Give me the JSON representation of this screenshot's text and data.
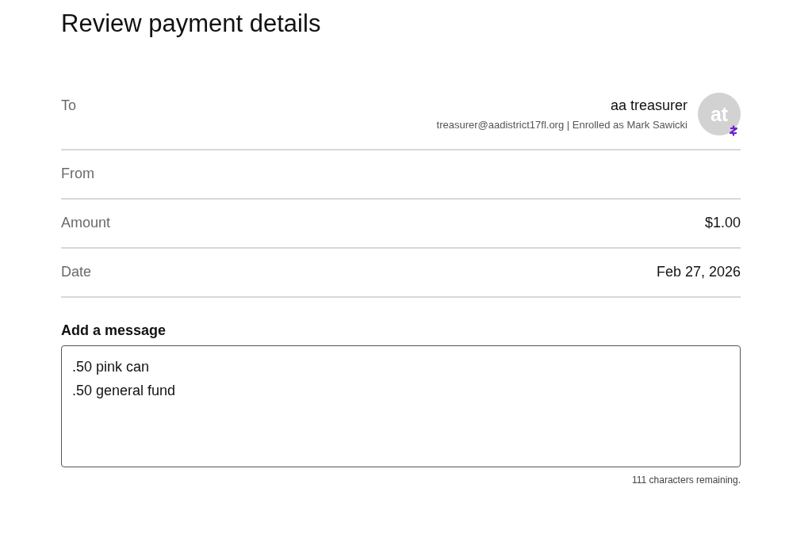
{
  "title": "Review payment details",
  "details": [
    {
      "kind": "recipient",
      "label": "To",
      "name": "aa treasurer",
      "subtitle": "treasurer@aadistrict17fl.org | Enrolled as Mark Sawicki",
      "avatar_initials": "at"
    },
    {
      "kind": "value",
      "label": "From"
    },
    {
      "kind": "value",
      "label": "Amount",
      "value": "$1.00"
    },
    {
      "kind": "value",
      "label": "Date",
      "value": "Feb 27, 2026"
    }
  ],
  "message": {
    "label": "Add a message",
    "value": ".50 pink can\n.50 general fund",
    "remaining": "111 characters remaining."
  }
}
